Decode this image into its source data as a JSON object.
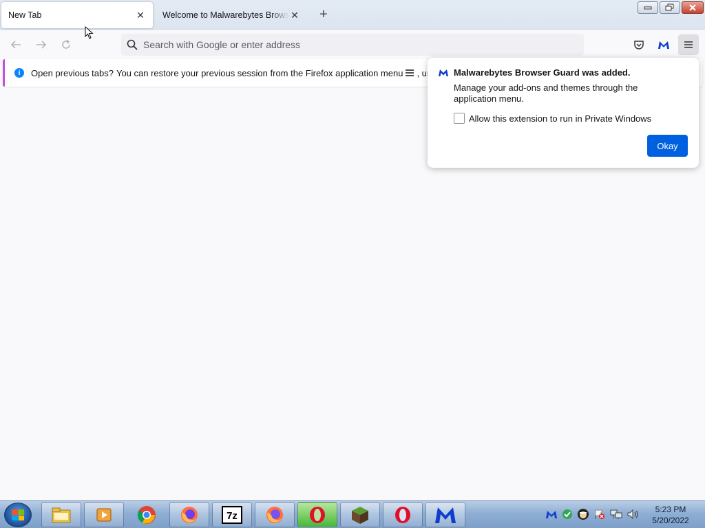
{
  "tabs": [
    {
      "label": "New Tab",
      "active": true
    },
    {
      "label": "Welcome to Malwarebytes Browser Guard",
      "active": false
    }
  ],
  "urlbar": {
    "placeholder": "Search with Google or enter address"
  },
  "notification": {
    "bold": "Open previous tabs?",
    "text": "You can restore your previous session from the Firefox application menu",
    "text_after": ", under History"
  },
  "panel": {
    "title": "Malwarebytes Browser Guard was added.",
    "description": "Manage your add-ons and themes through the application menu.",
    "checkbox_label": "Allow this extension to run in Private Windows",
    "checkbox_checked": false,
    "ok_label": "Okay"
  },
  "taskbar": {
    "time": "5:23 PM",
    "date": "5/20/2022",
    "apps": [
      "file-explorer",
      "media-player",
      "chrome",
      "firefox",
      "7zip",
      "firefox",
      "opera-gx",
      "minecraft",
      "opera",
      "malwarebytes"
    ]
  },
  "colors": {
    "accent": "#0061e0",
    "notification_stripe": "#c34fd6",
    "info_blue": "#0a84ff",
    "malwarebytes_blue": "#0d3ecc"
  }
}
